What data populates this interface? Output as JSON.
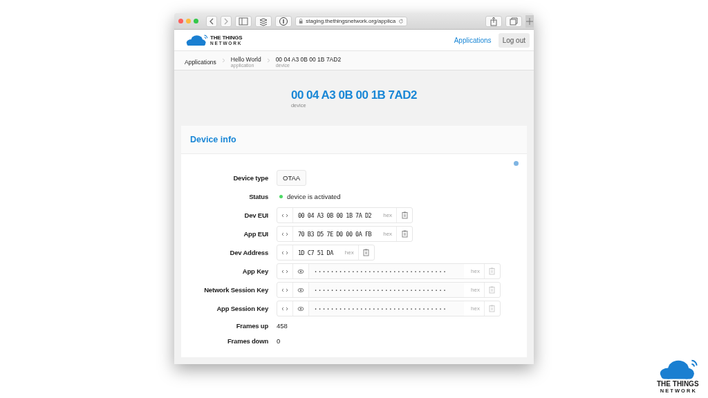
{
  "browser": {
    "url": "staging.thethingsnetwork.org/applica"
  },
  "header": {
    "logo_top": "THE THINGS",
    "logo_bottom": "N E T W O R K",
    "nav_link": "Applications",
    "logout": "Log out"
  },
  "breadcrumb": [
    {
      "label": "Applications"
    },
    {
      "label": "Hello World",
      "sub": "application"
    },
    {
      "label": "00 04 A3 0B 00 1B 7AD2",
      "sub": "device"
    }
  ],
  "title": {
    "value": "00 04 A3 0B 00 1B 7AD2",
    "sub": "device"
  },
  "card": {
    "heading": "Device info",
    "rows": [
      {
        "kind": "badge",
        "label": "Device type",
        "value": "OTAA"
      },
      {
        "kind": "status",
        "label": "Status",
        "value": "device is activated",
        "color": "#4cd964"
      },
      {
        "kind": "hex",
        "label": "Dev EUI",
        "value": "00 04 A3 0B 00 1B 7A D2",
        "unit": "hex"
      },
      {
        "kind": "hex",
        "label": "App EUI",
        "value": "70 B3 D5 7E D0 00 0A FB",
        "unit": "hex"
      },
      {
        "kind": "hex",
        "label": "Dev Address",
        "value": "1D C7 51 DA",
        "unit": "hex"
      },
      {
        "kind": "secret",
        "label": "App Key",
        "value": "································",
        "unit": "hex"
      },
      {
        "kind": "secret",
        "label": "Network Session Key",
        "value": "································",
        "unit": "hex"
      },
      {
        "kind": "secret",
        "label": "App Session Key",
        "value": "································",
        "unit": "hex"
      },
      {
        "kind": "text",
        "label": "Frames up",
        "value": "458"
      },
      {
        "kind": "text",
        "label": "Frames down",
        "value": "0"
      }
    ]
  },
  "corner_logo": {
    "top": "THE THINGS",
    "bottom": "N E T W O R K"
  }
}
